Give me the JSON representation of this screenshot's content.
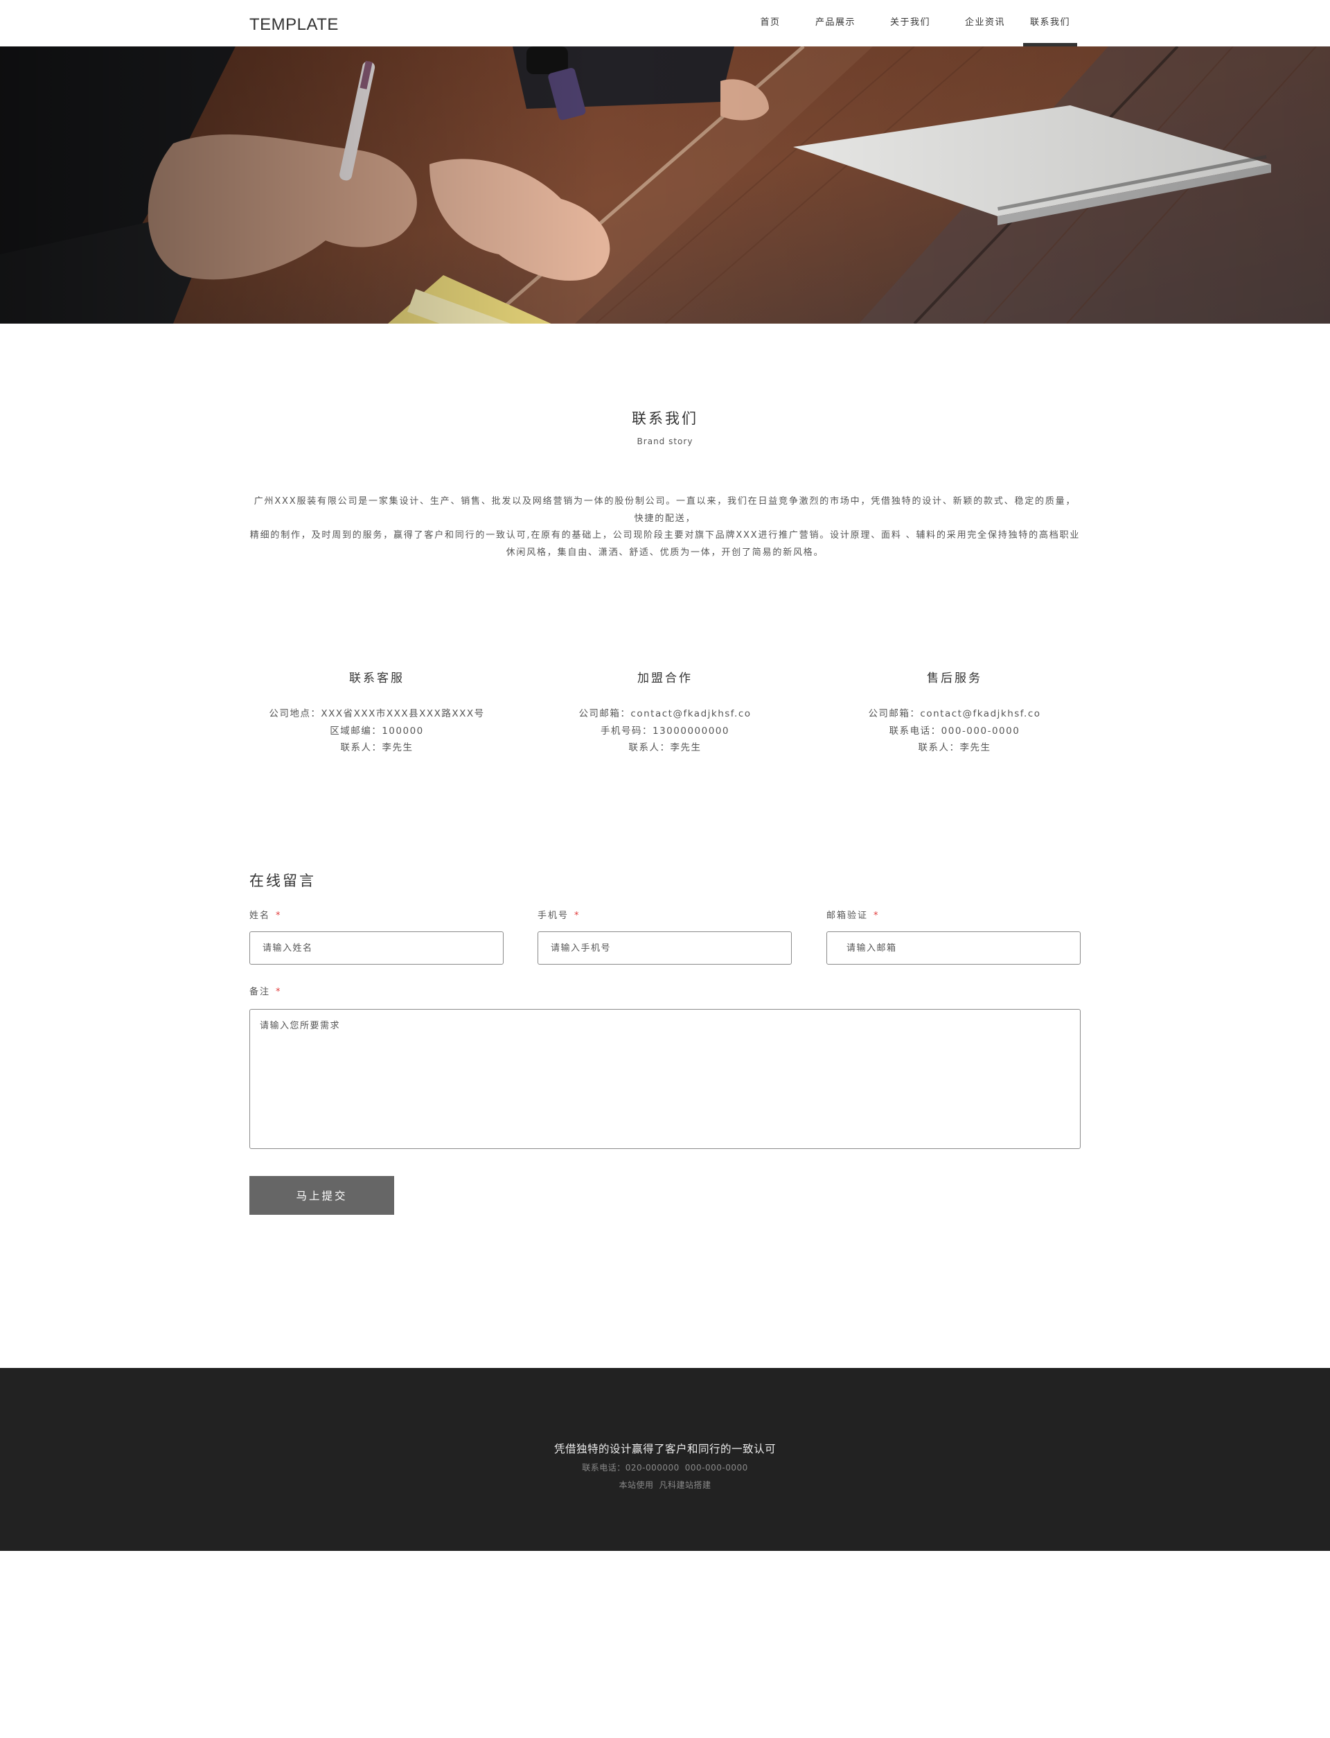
{
  "header": {
    "logo": "TEMPLATE",
    "nav": [
      {
        "label": "首页"
      },
      {
        "label": "产品展示"
      },
      {
        "label": "关于我们"
      },
      {
        "label": "企业资讯"
      },
      {
        "label": "联系我们"
      }
    ],
    "active_nav": "联系我们"
  },
  "intro": {
    "title": "联系我们",
    "subtitle": "Brand story",
    "paragraph_1": "广州XXX服装有限公司是一家集设计、生产、销售、批发以及网络营销为一体的股份制公司。一直以来，我们在日益竞争激烈的市场中，凭借独特的设计、新颖的款式、稳定的质量，快捷的配送，",
    "paragraph_2": "精细的制作，及时周到的服务，赢得了客户和同行的一致认可,在原有的基础上，公司现阶段主要对旗下品牌XXX进行推广营销。设计原理、面料 、辅料的采用完全保持独特的高档职业休闲风格，集自由、潇洒、舒适、优质为一体，开创了简易的新风格。"
  },
  "contact_columns": [
    {
      "title": "联系客服",
      "lines": [
        "公司地点：XXX省XXX市XXX县XXX路XXX号",
        "区域邮编：100000",
        "联系人：李先生"
      ]
    },
    {
      "title": "加盟合作",
      "lines": [
        "公司邮箱：contact@fkadjkhsf.co",
        "手机号码：13000000000",
        "联系人：李先生"
      ]
    },
    {
      "title": "售后服务",
      "lines": [
        "公司邮箱：contact@fkadjkhsf.co",
        "联系电话：000-000-0000",
        "联系人：李先生"
      ]
    }
  ],
  "form": {
    "title": "在线留言",
    "required_mark": "*",
    "name": {
      "label": "姓名",
      "placeholder": "请输入姓名"
    },
    "phone": {
      "label": "手机号",
      "placeholder": "请输入手机号"
    },
    "email": {
      "label": "邮箱验证",
      "placeholder": "请输入邮箱"
    },
    "remark": {
      "label": "备注",
      "placeholder": "请输入您所要需求"
    },
    "submit_label": "马上提交"
  },
  "footer": {
    "title": "凭借独特的设计赢得了客户和同行的一致认可",
    "phone_label": "联系电话：020-000000",
    "phone_alt": "000-000-0000",
    "powered_text": "本站使用",
    "powered_link": "凡科建站搭建"
  },
  "colors": {
    "footer_bg": "#222222",
    "submit_bg": "#666666",
    "required_mark": "#e03b3b",
    "accent": "#333333"
  }
}
